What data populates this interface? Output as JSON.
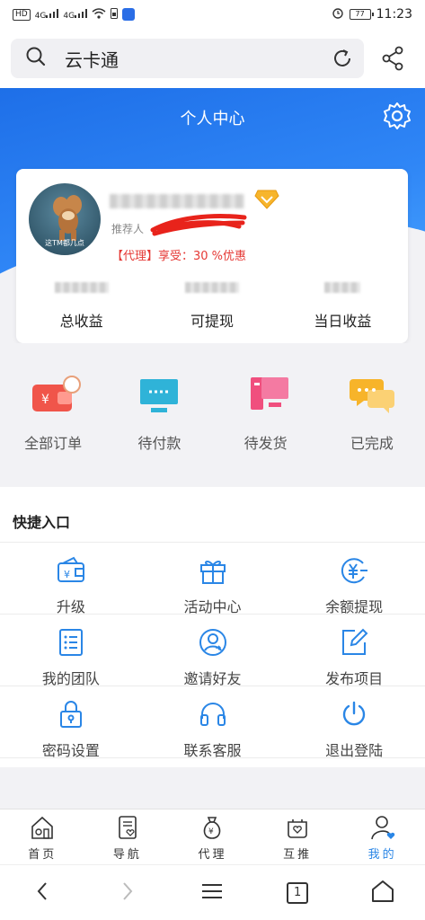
{
  "status_bar": {
    "time": "11:23",
    "battery": "77",
    "hd": "HD",
    "net1": "4G",
    "net2": "4G"
  },
  "search": {
    "text": "云卡通"
  },
  "header": {
    "title": "个人中心"
  },
  "profile": {
    "avatar_caption": "这TM都几点",
    "referrer_label": "推荐人",
    "agent_text": "【代理】享受：30 %优惠",
    "stats": [
      {
        "label": "总收益"
      },
      {
        "label": "可提现"
      },
      {
        "label": "当日收益"
      }
    ]
  },
  "orders": [
    {
      "label": "全部订单",
      "icon": "wallet-icon"
    },
    {
      "label": "待付款",
      "icon": "monitor-icon"
    },
    {
      "label": "待发货",
      "icon": "computer-icon"
    },
    {
      "label": "已完成",
      "icon": "chat-icon"
    }
  ],
  "quick": {
    "title": "快捷入口",
    "items": [
      {
        "label": "升级",
        "icon": "wallet-card-icon"
      },
      {
        "label": "活动中心",
        "icon": "gift-icon"
      },
      {
        "label": "余额提现",
        "icon": "yuan-icon"
      },
      {
        "label": "我的团队",
        "icon": "list-icon"
      },
      {
        "label": "邀请好友",
        "icon": "user-circle-icon"
      },
      {
        "label": "发布项目",
        "icon": "edit-icon"
      },
      {
        "label": "密码设置",
        "icon": "lock-icon"
      },
      {
        "label": "联系客服",
        "icon": "headset-icon"
      },
      {
        "label": "退出登陆",
        "icon": "power-icon"
      }
    ]
  },
  "tabs": [
    {
      "label": "首页",
      "icon": "home-icon"
    },
    {
      "label": "导航",
      "icon": "doc-icon"
    },
    {
      "label": "代理",
      "icon": "money-bag-icon"
    },
    {
      "label": "互推",
      "icon": "heart-box-icon"
    },
    {
      "label": "我的",
      "icon": "person-icon",
      "active": true
    }
  ],
  "sysnav": {
    "tab_count": "1"
  },
  "colors": {
    "primary_blue": "#2a86e6",
    "header_blue": "#1e6fe8",
    "agent_red": "#e53935"
  }
}
